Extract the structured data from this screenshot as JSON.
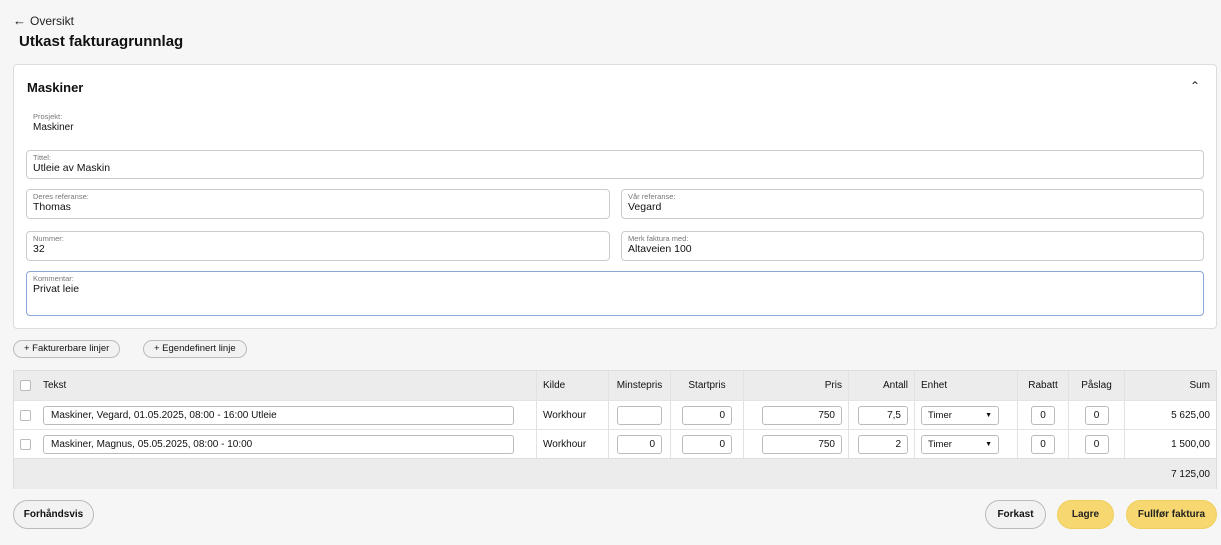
{
  "nav": {
    "back_arrow": "←",
    "back_label": "Oversikt"
  },
  "page": {
    "title": "Utkast fakturagrunnlag"
  },
  "section": {
    "title": "Maskiner",
    "collapse_glyph": "⌃",
    "project": {
      "label": "Prosjekt:",
      "value": "Maskiner"
    },
    "fields": {
      "tittel": {
        "label": "Tittel:",
        "value": "Utleie av Maskin"
      },
      "deres_referanse": {
        "label": "Deres referanse:",
        "value": "Thomas"
      },
      "var_referanse": {
        "label": "Vår referanse:",
        "value": "Vegard"
      },
      "nummer": {
        "label": "Nummer:",
        "value": "32"
      },
      "merk_faktura": {
        "label": "Merk faktura med:",
        "value": "Altaveien 100"
      },
      "kommentar": {
        "label": "Kommentar:",
        "value": "Privat leie"
      }
    }
  },
  "actions": {
    "add_billable": "+ Fakturerbare linjer",
    "add_custom": "+ Egendefinert linje"
  },
  "table": {
    "headers": {
      "tekst": "Tekst",
      "kilde": "Kilde",
      "minstepris": "Minstepris",
      "startpris": "Startpris",
      "pris": "Pris",
      "antall": "Antall",
      "enhet": "Enhet",
      "rabatt": "Rabatt",
      "paslag": "Påslag",
      "sum": "Sum"
    },
    "rows": [
      {
        "tekst": "Maskiner, Vegard, 01.05.2025, 08:00 - 16:00  Utleie",
        "kilde": "Workhour",
        "minstepris": "",
        "startpris": "0",
        "pris": "750",
        "antall": "7,5",
        "enhet": "Timer",
        "rabatt": "0",
        "paslag": "0",
        "sum": "5 625,00"
      },
      {
        "tekst": "Maskiner, Magnus, 05.05.2025, 08:00 - 10:00",
        "kilde": "Workhour",
        "minstepris": "0",
        "startpris": "0",
        "pris": "750",
        "antall": "2",
        "enhet": "Timer",
        "rabatt": "0",
        "paslag": "0",
        "sum": "1 500,00"
      }
    ],
    "total": "7 125,00"
  },
  "footer": {
    "preview": "Forhåndsvis",
    "discard": "Forkast",
    "save": "Lagre",
    "complete": "Fullfør faktura"
  },
  "colors": {
    "primary_yellow": "#f7d770",
    "background": "#f6f6f6"
  }
}
